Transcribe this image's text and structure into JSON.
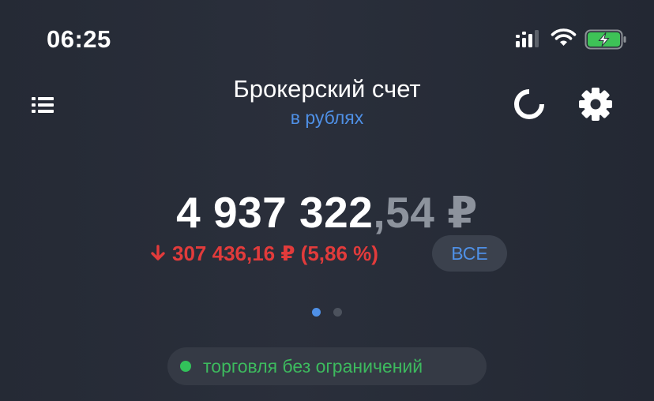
{
  "status_bar": {
    "time": "06:25",
    "icons": [
      "signal-icon",
      "wifi-icon",
      "battery-charging-icon"
    ]
  },
  "header": {
    "title": "Брокерский счет",
    "subtitle": "в рублях",
    "icons": [
      "menu-list-icon",
      "refresh-icon",
      "gear-icon"
    ]
  },
  "portfolio": {
    "balance_int": "4 937 322",
    "balance_frac": ",54 ₽",
    "change": "307 436,16 ₽ (5,86 %)",
    "change_direction": "down",
    "period_label": "ВСЕ"
  },
  "pager": {
    "pages": 2,
    "active": 0
  },
  "trading_status": {
    "label": "торговля без ограничений"
  },
  "colors": {
    "background": "#272c37",
    "accent_blue": "#4f90e6",
    "negative_red": "#e23b3b",
    "positive_green": "#3dba5e",
    "muted_gray": "#8d939d"
  }
}
